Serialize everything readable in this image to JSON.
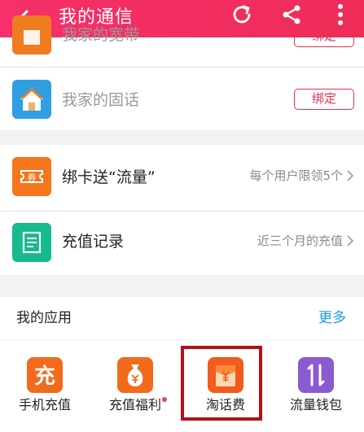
{
  "header": {
    "title": "我的通信",
    "back_icon": "arrow-left-icon",
    "refresh_icon": "refresh-icon",
    "share_icon": "share-icon",
    "more_icon": "more-vertical-icon",
    "color": "#f5306a"
  },
  "bindings": {
    "partial_row": {
      "label": "我家的宽带",
      "button": "绑定"
    },
    "landline_row": {
      "label": "我家的固话",
      "button": "绑定"
    }
  },
  "promo": {
    "card_row": {
      "label": "绑卡送“流量”",
      "hint": "每个用户限领5个",
      "icon_text": "券"
    },
    "history_row": {
      "label": "充值记录",
      "hint": "近三个月的充值"
    }
  },
  "apps": {
    "title": "我的应用",
    "more": "更多",
    "items": [
      {
        "label": "手机充值",
        "icon_text": "充",
        "color": "#f26a1b"
      },
      {
        "label": "充值福利",
        "icon": "money-bag-icon",
        "color": "#f26a1b",
        "badge": true
      },
      {
        "label": "淘话费",
        "icon": "red-envelope-icon",
        "color": "#f25a1e"
      },
      {
        "label": "流量钱包",
        "icon": "transfer-arrows-icon",
        "color": "#8a5bd0"
      }
    ]
  },
  "colors": {
    "accent_red": "#e8304e",
    "link_blue": "#1e9ae6",
    "highlight_box": "#b3101b"
  }
}
